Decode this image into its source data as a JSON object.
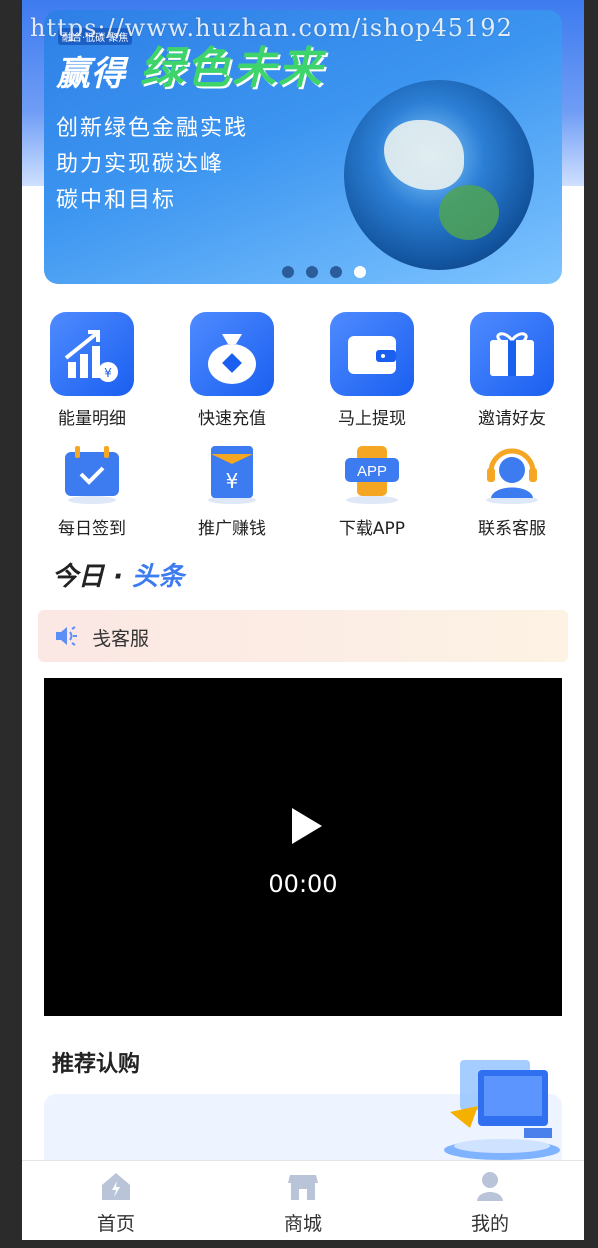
{
  "watermark": "https://www.huzhan.com/ishop45192",
  "banner": {
    "tagline": "融合·低碳·聚焦",
    "headline_white": "赢得",
    "headline_green": "绿色未来",
    "lines": [
      "创新绿色金融实践",
      "助力实现碳达峰",
      "碳中和目标"
    ],
    "dots": 4,
    "active_dot": 3
  },
  "menu": {
    "row1": [
      {
        "label": "能量明细",
        "icon": "chart-money-icon"
      },
      {
        "label": "快速充值",
        "icon": "money-bag-icon"
      },
      {
        "label": "马上提现",
        "icon": "wallet-icon"
      },
      {
        "label": "邀请好友",
        "icon": "gift-icon"
      }
    ],
    "row2": [
      {
        "label": "每日签到",
        "icon": "calendar-check-icon"
      },
      {
        "label": "推广赚钱",
        "icon": "yen-envelope-icon"
      },
      {
        "label": "下载APP",
        "icon": "app-download-icon"
      },
      {
        "label": "联系客服",
        "icon": "headset-icon"
      }
    ]
  },
  "headline": {
    "part1": "今日",
    "dot": "·",
    "part2": "头条"
  },
  "notice": {
    "text": "戋客服"
  },
  "video": {
    "time": "00:00"
  },
  "recommend": {
    "title": "推荐认购"
  },
  "tabbar": [
    {
      "label": "首页",
      "icon": "home-icon"
    },
    {
      "label": "商城",
      "icon": "shop-icon"
    },
    {
      "label": "我的",
      "icon": "user-icon"
    }
  ],
  "colors": {
    "brand": "#3d7bf0",
    "accent_green": "#3fd36b"
  }
}
